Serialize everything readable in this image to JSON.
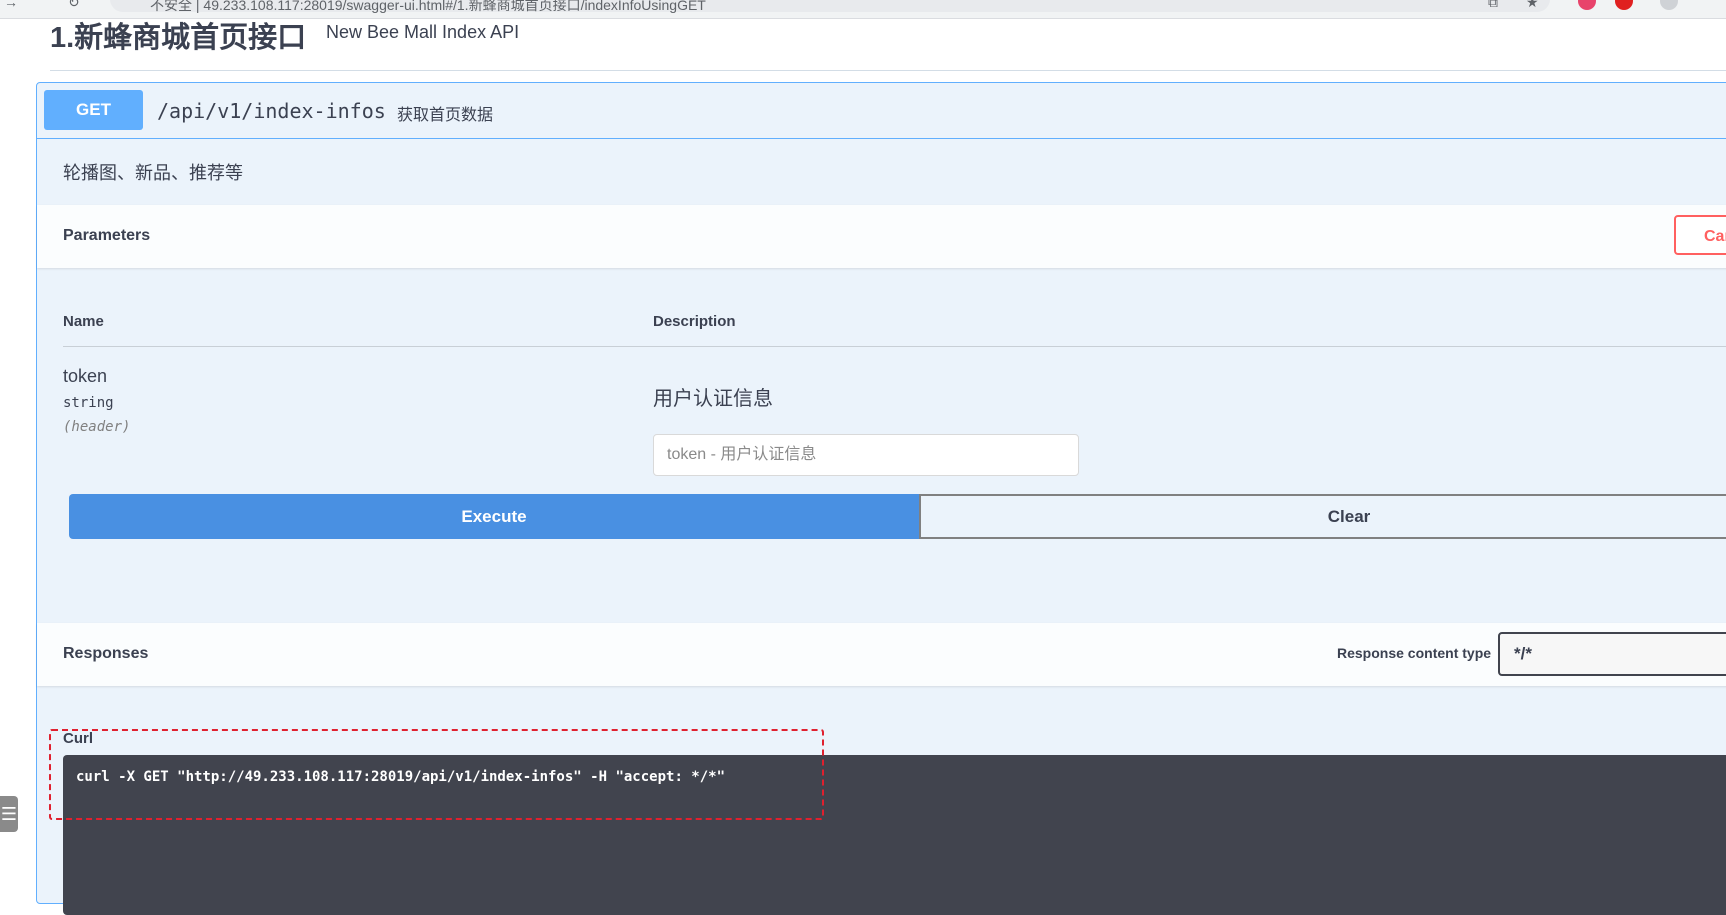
{
  "browser": {
    "address": "不安全 | 49.233.108.117:28019/swagger-ui.html#/1.新蜂商城首页接口/indexInfoUsingGET"
  },
  "tag": {
    "title": "1.新蜂商城首页接口",
    "description": "New Bee Mall Index API"
  },
  "operation": {
    "method": "GET",
    "path": "/api/v1/index-infos",
    "summary": "获取首页数据",
    "description": "轮播图、新品、推荐等"
  },
  "parameters": {
    "title": "Parameters",
    "cancel_label": "Cancel",
    "col_name": "Name",
    "col_description": "Description",
    "items": [
      {
        "name": "token",
        "type": "string",
        "in": "(header)",
        "description": "用户认证信息",
        "placeholder": "token - 用户认证信息",
        "value": ""
      }
    ]
  },
  "actions": {
    "execute_label": "Execute",
    "clear_label": "Clear"
  },
  "responses": {
    "title": "Responses",
    "content_type_label": "Response content type",
    "content_type_value": "*/*",
    "curl_label": "Curl",
    "curl_command": "curl -X GET \"http://49.233.108.117:28019/api/v1/index-infos\" -H \"accept: */*\""
  },
  "colors": {
    "get_blue": "#61affe",
    "execute_blue": "#4990e2",
    "cancel_red": "#ff6060",
    "highlight_red": "#e0202e",
    "code_bg": "#41444e"
  }
}
